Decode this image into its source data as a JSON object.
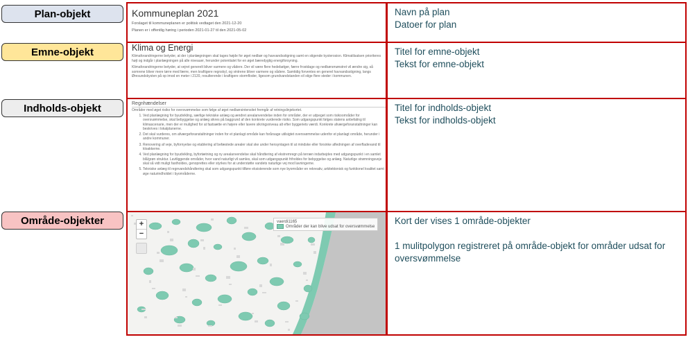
{
  "labels": {
    "plan": "Plan-objekt",
    "emne": "Emne-objekt",
    "indhold": "Indholds-objekt",
    "omraade": "Område-objekter"
  },
  "plan_panel": {
    "title": "Kommuneplan 2021",
    "line1": "Forslaget til kommuneplanen er politisk vedtaget den 2021-12-20",
    "line2": "Planen er i offentlig høring i perioden 2021-01-27 til den 2021-05-02"
  },
  "emne_panel": {
    "title": "Klima og Energi",
    "paragraph1": "Klimaforandringerne betyder, at der i planlægningen skal tages højde for øget nedbør og havvandsstigning samt en stigende kysterosion. Klimatilsatsen prioriteres højt og indgår i planlægningen på alle niveauer, herunder potentialet for en øget bæredygtig energiforsyning.",
    "paragraph2": "Klimaforandringerne betyder, at vejret generelt bliver varmere og vådere. Der vil være flere hedebølger, færre frostdage og nedbørsmønstret vil ændre sig, så somrene bliver mere tørre med færre, men kraftigere regnskyl, og vintrene bliver varmere og vådere. Samtidig forventes en generel havvandsstigning, langs Øresundskysten på op imod en meter i 2120, resulterende i kraftigere stormfloder, ligesom grundvandstanden vil stige flere steder i kommunen."
  },
  "indhold_panel": {
    "heading": "Regnhændelser",
    "intro": "Områder med øget risiko for oversvømmelse som følge af øget nedbørsintensitet fremgår af retningslinjekortet.",
    "items": [
      "Ved planlægning for byudvikling, særlige tekniske anlæg og ændret arealanvendelse inden for områder, der er udpeget som risikoområder for oversvømmelse, skal bebyggelse og anlæg sikres på baggrund af den konkrete vurderede risiko. Som udgangspunkt følges statens anbefaling til klimascenarie, men der er mulighed for at fastsætte en højere eller lavere sikringsniveau alt efter byggeriets værdi. Konkrete afværgeforanstaltninger kan beskrives i lokalplanerne.",
      "Det skal vurderes, om afværgeforanstaltninger inden for et planlagt område kan forårsage utilsigtet oversvømmelse udenfor et planlagt område, herunder i andre kommuner.",
      "Renovering af veje, byfornyelse og etablering af befæstede arealer skal ske under hensyntagen til at mindske eller forsinke afledningen af overfladevand til kloakkerne.",
      "Ved planlægning for byudvikling, byfortætning og ny arealanvendelse skal håndtering af ekstremregn på terræn indarbejdes med udgangspunkt i en samlet blå/grøn struktur. Lavtliggende områder, hvor vand naturligt vil samles, skal som udgangspunkt friholdes for bebyggelse og anlæg. Naturlige strømningsveje skal så vidt muligt fastholdes, genoprettes eller styrkes for at understøtte vandets naturlige vej mod lavningerne.",
      "Tekniske anlæg til regnvandshåndtering skal som udgangspunkt tilføre eksisterende som nye byområder en rekreativ, arkitektonisk og funktionel kvalitet samt øge naturindholdet i byområderne."
    ]
  },
  "map_panel": {
    "zoom_in": "+",
    "zoom_out": "−",
    "legend_title": "vaerdi1165",
    "legend_item": "Områder der kan blive udsat for oversvømmelse",
    "flood_color": "#7ecab1",
    "sea_color": "#c4c4c4",
    "land_color": "#f3f3f1"
  },
  "descriptions": {
    "plan": [
      "Navn på plan",
      "Datoer for plan"
    ],
    "emne": [
      "Titel for emne-objekt",
      "Tekst for emne-objekt"
    ],
    "indhold": [
      "Titel for indholds-objekt",
      "Tekst for indholds-objekt"
    ],
    "omraade_line1": "Kort der vises 1 område-objekter",
    "omraade_line2": "1 mulitpolygon registreret på område-objekt for områder udsat for oversvømmelse"
  }
}
